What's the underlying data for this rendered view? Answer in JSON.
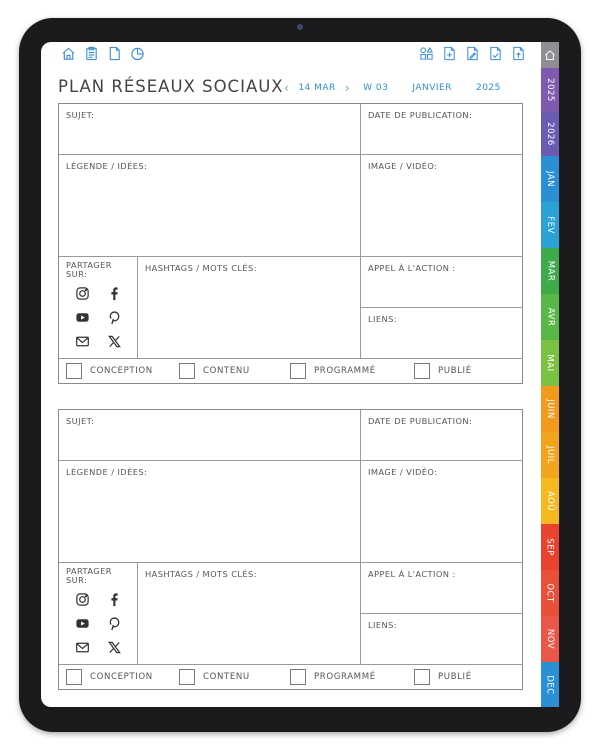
{
  "toolbar": {
    "left_icons": [
      "home-icon",
      "clipboard-icon",
      "document-icon",
      "pie-chart-icon"
    ],
    "right_icons": [
      "grid-shapes-icon",
      "file-plus-icon",
      "file-edit-icon",
      "file-check-icon",
      "file-export-icon"
    ]
  },
  "header": {
    "title": "PLAN RÉSEAUX SOCIAUX",
    "prev_arrow": "‹",
    "date": "14 MAR",
    "next_arrow": "›",
    "week": "W 03",
    "month": "JANVIER",
    "year": "2025",
    "accent_color": "#2f8fd8"
  },
  "labels": {
    "subject": "SUJET:",
    "publish_date": "DATE DE PUBLICATION:",
    "caption": "LÉGENDE / IDÉES:",
    "media": "IMAGE / VIDÉO:",
    "share_line1": "PARTAGER",
    "share_line2": "SUR:",
    "hashtags": "HASHTAGS / MOTS CLÉS:",
    "cta": "APPEL À L'ACTION :",
    "links": "LIENS:"
  },
  "status": {
    "design": "CONCEPTION",
    "content": "CONTENU",
    "scheduled": "PROGRAMMÉ",
    "published": "PUBLIÉ"
  },
  "social_icons": [
    "instagram-icon",
    "facebook-icon",
    "youtube-icon",
    "pinterest-icon",
    "mail-icon",
    "x-icon"
  ],
  "side_tabs": [
    {
      "label": "",
      "color": "#8e8e93",
      "icon": "home-icon"
    },
    {
      "label": "2025",
      "color": "#7f5bb0"
    },
    {
      "label": "2026",
      "color": "#6b5bb3"
    },
    {
      "label": "JAN",
      "color": "#2b8fd6"
    },
    {
      "label": "FEV",
      "color": "#2ba2d6"
    },
    {
      "label": "MAR",
      "color": "#3faa4a"
    },
    {
      "label": "AVR",
      "color": "#58b847"
    },
    {
      "label": "MAI",
      "color": "#7cc242"
    },
    {
      "label": "JUIN",
      "color": "#f39a1c"
    },
    {
      "label": "JUIL",
      "color": "#f2a51c"
    },
    {
      "label": "AOÛ",
      "color": "#f6b820"
    },
    {
      "label": "SEP",
      "color": "#e8432e"
    },
    {
      "label": "OCT",
      "color": "#e9503a"
    },
    {
      "label": "NOV",
      "color": "#e8574a"
    },
    {
      "label": "DEC",
      "color": "#2b8fd6"
    }
  ]
}
